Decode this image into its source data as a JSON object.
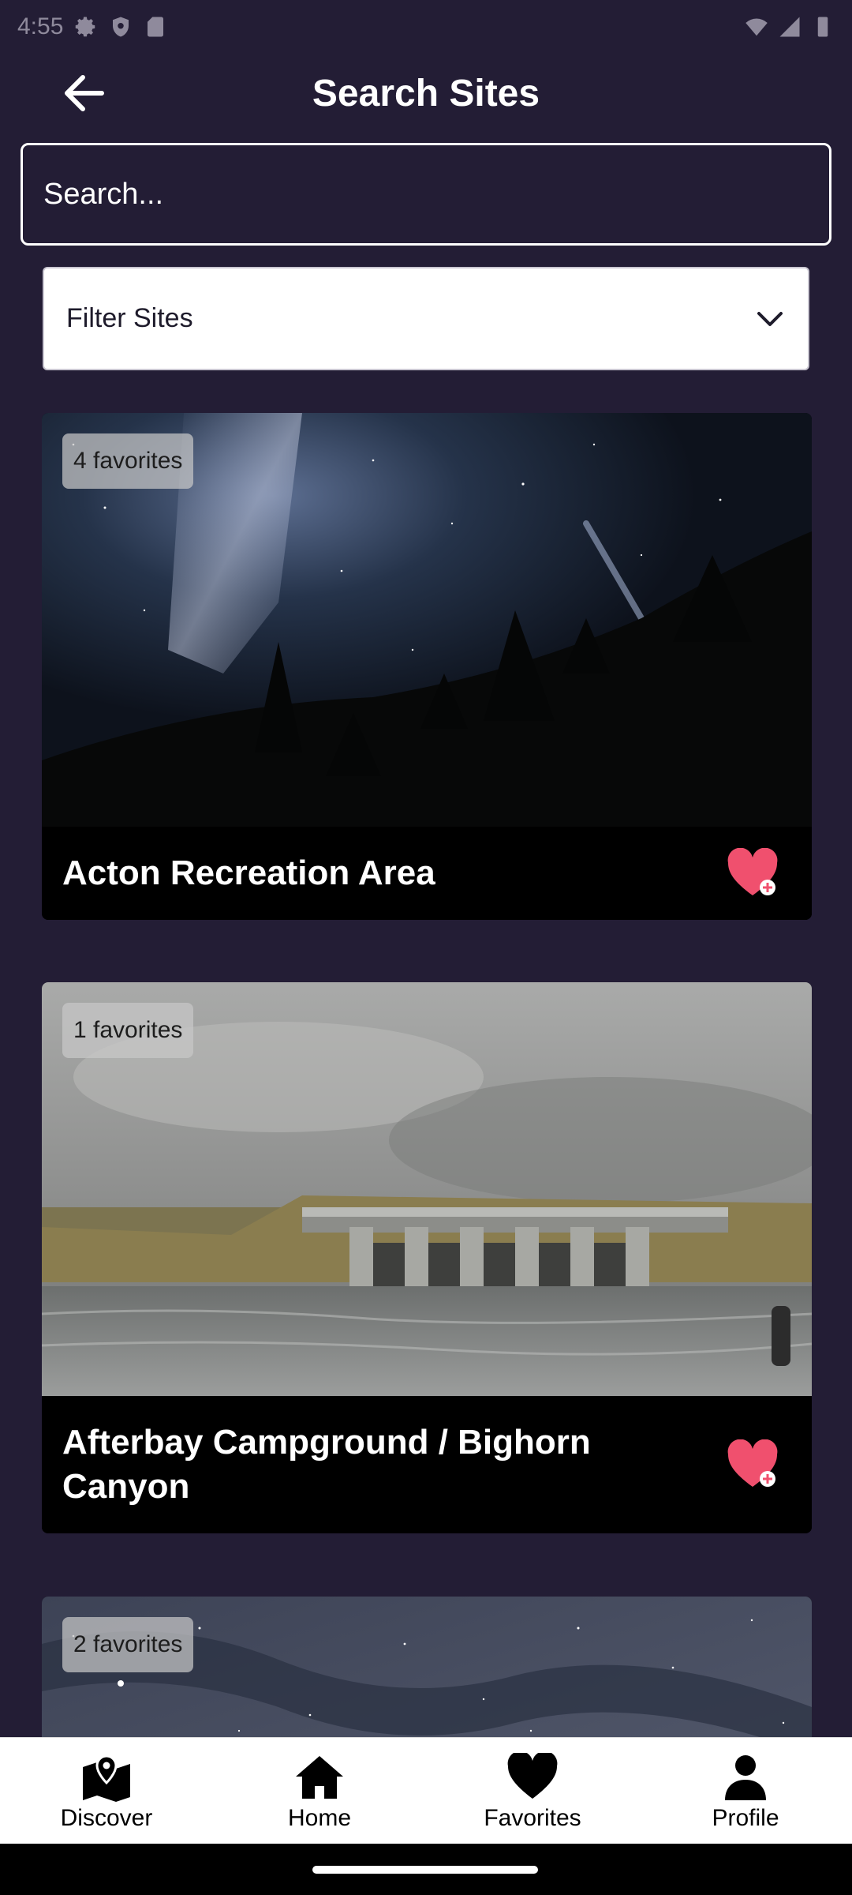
{
  "status_bar": {
    "time": "4:55"
  },
  "header": {
    "title": "Search Sites"
  },
  "search": {
    "placeholder": "Search..."
  },
  "filter": {
    "label": "Filter Sites"
  },
  "sites": [
    {
      "favorites_label": "4 favorites",
      "title": "Acton Recreation Area"
    },
    {
      "favorites_label": "1 favorites",
      "title": "Afterbay Campground / Bighorn Canyon"
    },
    {
      "favorites_label": "2 favorites",
      "title": ""
    }
  ],
  "bottom_nav": {
    "discover": "Discover",
    "home": "Home",
    "favorites": "Favorites",
    "profile": "Profile"
  },
  "colors": {
    "background": "#231d35",
    "card_footer": "#000000",
    "heart": "#f0506e",
    "nav_background": "#ffffff"
  }
}
